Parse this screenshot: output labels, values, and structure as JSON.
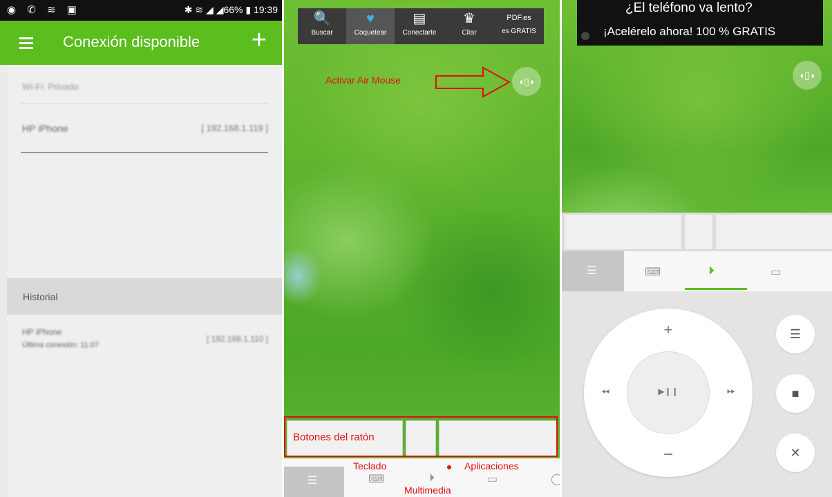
{
  "panel1": {
    "status_left": "◉ ✆ ≋ ▣",
    "status_right": "✱ ≋ ◢ ◢66% ▮ 19:39",
    "title": "Conexión disponible",
    "plus": "+",
    "wifi_section": "Wi-Fi: Privado",
    "device_name": "HP iPhone",
    "device_ip": "[ 192.168.1.119 ]",
    "history_label": "Historial",
    "history_name": "HP iPhone",
    "history_sub": "Última conexión: 11:07",
    "history_ip": "[ 192.168.1.110 ]"
  },
  "panel2": {
    "toolbar": [
      {
        "icon": "🔍",
        "label": "Buscar"
      },
      {
        "icon": "♥",
        "label": "Coquetear"
      },
      {
        "icon": "▤",
        "label": "Conectarte"
      },
      {
        "icon": "♛",
        "label": "Citar"
      },
      {
        "icon": "PDF.es",
        "label": "es GRATIS"
      }
    ],
    "air_mouse_label": "Activar Air Mouse",
    "air_icon": "◖▯◗",
    "mouse_buttons_label": "Botones del ratón",
    "keyboard_label": "Teclado",
    "apps_label": "Aplicaciones",
    "multimedia_label": "Multimedia"
  },
  "panel3": {
    "ad_title": "¿El teléfono va lento?",
    "ad_text": "¡Acelérelo ahora! 100 % GRATIS",
    "air_icon": "◖▯◗",
    "vol_up": "+",
    "vol_down": "−",
    "prev": "◂◂",
    "next": "▸▸",
    "play_pause": "▶❙❙",
    "list_icon": "☰",
    "stop_icon": "■",
    "close_icon": "✕"
  },
  "colors": {
    "accent": "#5cbd1e",
    "annotation": "#e01010"
  }
}
